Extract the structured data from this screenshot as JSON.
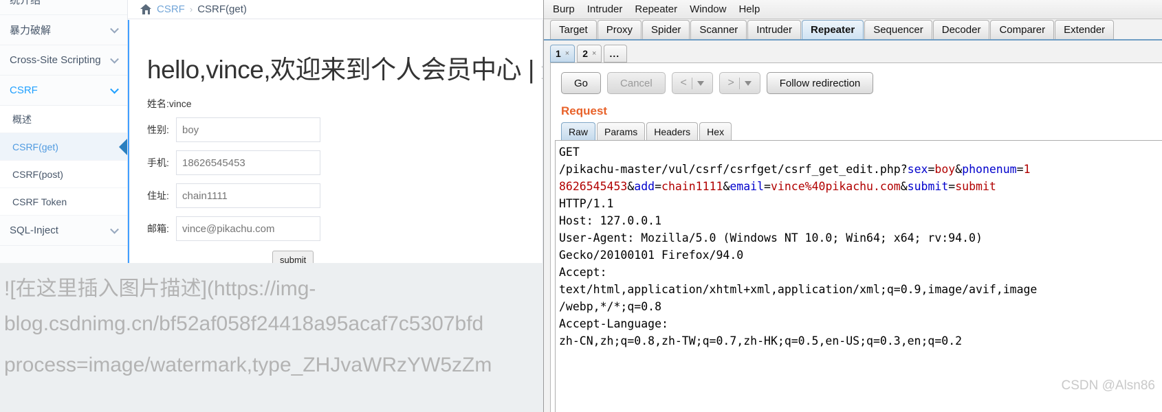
{
  "pikachu": {
    "breadcrumb": {
      "home_icon": "home-icon",
      "parent": "CSRF",
      "separator": "›",
      "current": "CSRF(get)"
    },
    "sidebar": {
      "items": [
        {
          "label": "统介绍",
          "type": "group",
          "caret": false,
          "active": false
        },
        {
          "label": "暴力破解",
          "type": "group",
          "caret": true,
          "active": false
        },
        {
          "label": "Cross-Site Scripting",
          "type": "group",
          "caret": true,
          "active": false
        },
        {
          "label": "CSRF",
          "type": "group",
          "caret": true,
          "active": true
        }
      ],
      "sub_items": [
        {
          "label": "概述",
          "selected": false
        },
        {
          "label": "CSRF(get)",
          "selected": true
        },
        {
          "label": "CSRF(post)",
          "selected": false
        },
        {
          "label": "CSRF Token",
          "selected": false
        }
      ],
      "trailing_items": [
        {
          "label": "SQL-Inject",
          "type": "group",
          "caret": true,
          "active": false
        }
      ]
    },
    "content": {
      "title": "hello,vince,欢迎来到个人会员中心 | 退",
      "name_line": "姓名:vince",
      "fields": [
        {
          "label": "性别:",
          "value": "boy"
        },
        {
          "label": "手机:",
          "value": "18626545453"
        },
        {
          "label": "住址:",
          "value": "chain1111"
        },
        {
          "label": "邮箱:",
          "value": "vince@pikachu.com"
        }
      ],
      "submit_label": "submit",
      "dashes": "--"
    },
    "watermark_lines": [
      "![在这里插入图片描述](https://img-",
      "blog.csdnimg.cn/bf52af058f24418a95acaf7c5307bfd",
      "process=image/watermark,type_ZHJvaWRzYW5zZm"
    ]
  },
  "burp": {
    "menu": [
      "Burp",
      "Intruder",
      "Repeater",
      "Window",
      "Help"
    ],
    "main_tabs": [
      {
        "label": "Target",
        "selected": false
      },
      {
        "label": "Proxy",
        "selected": false
      },
      {
        "label": "Spider",
        "selected": false
      },
      {
        "label": "Scanner",
        "selected": false
      },
      {
        "label": "Intruder",
        "selected": false
      },
      {
        "label": "Repeater",
        "selected": true
      },
      {
        "label": "Sequencer",
        "selected": false
      },
      {
        "label": "Decoder",
        "selected": false
      },
      {
        "label": "Comparer",
        "selected": false
      },
      {
        "label": "Extender",
        "selected": false
      }
    ],
    "repeater_tabs": [
      {
        "label": "1",
        "close": "×",
        "selected": true
      },
      {
        "label": "2",
        "close": "×",
        "selected": false
      },
      {
        "label": "...",
        "close": "",
        "selected": false
      }
    ],
    "toolbar": {
      "go_label": "Go",
      "cancel_label": "Cancel",
      "prev_icon": "chevron-left-icon",
      "next_icon": "chevron-right-icon",
      "follow_redirection_label": "Follow redirection"
    },
    "request_label": "Request",
    "request_label_color": "#e8622a",
    "message_tabs": [
      {
        "label": "Raw",
        "selected": true
      },
      {
        "label": "Params",
        "selected": false
      },
      {
        "label": "Headers",
        "selected": false
      },
      {
        "label": "Hex",
        "selected": false
      }
    ],
    "raw_request": {
      "lines": [
        [
          {
            "t": "GET",
            "c": "plain"
          }
        ],
        [
          {
            "t": "/pikachu-master/vul/csrf/csrfget/csrf_get_edit.php?",
            "c": "plain"
          },
          {
            "t": "sex",
            "c": "key"
          },
          {
            "t": "=",
            "c": "plain"
          },
          {
            "t": "boy",
            "c": "val"
          },
          {
            "t": "&",
            "c": "plain"
          },
          {
            "t": "phonenum",
            "c": "key"
          },
          {
            "t": "=",
            "c": "plain"
          },
          {
            "t": "1",
            "c": "val"
          }
        ],
        [
          {
            "t": "8626545453",
            "c": "val"
          },
          {
            "t": "&",
            "c": "plain"
          },
          {
            "t": "add",
            "c": "key"
          },
          {
            "t": "=",
            "c": "plain"
          },
          {
            "t": "chain1111",
            "c": "val"
          },
          {
            "t": "&",
            "c": "plain"
          },
          {
            "t": "email",
            "c": "key"
          },
          {
            "t": "=",
            "c": "plain"
          },
          {
            "t": "vince%40pikachu.com",
            "c": "val"
          },
          {
            "t": "&",
            "c": "plain"
          },
          {
            "t": "submit",
            "c": "key"
          },
          {
            "t": "=",
            "c": "plain"
          },
          {
            "t": "submit",
            "c": "val"
          }
        ],
        [
          {
            "t": "HTTP/1.1",
            "c": "plain"
          }
        ],
        [
          {
            "t": "Host: 127.0.0.1",
            "c": "plain"
          }
        ],
        [
          {
            "t": "User-Agent: Mozilla/5.0 (Windows NT 10.0; Win64; x64; rv:94.0)",
            "c": "plain"
          }
        ],
        [
          {
            "t": "Gecko/20100101 Firefox/94.0",
            "c": "plain"
          }
        ],
        [
          {
            "t": "Accept:",
            "c": "plain"
          }
        ],
        [
          {
            "t": "text/html,application/xhtml+xml,application/xml;q=0.9,image/avif,image",
            "c": "plain"
          }
        ],
        [
          {
            "t": "/webp,*/*;q=0.8",
            "c": "plain"
          }
        ],
        [
          {
            "t": "Accept-Language:",
            "c": "plain"
          }
        ],
        [
          {
            "t": "zh-CN,zh;q=0.8,zh-TW;q=0.7,zh-HK;q=0.5,en-US;q=0.3,en;q=0.2",
            "c": "plain"
          }
        ]
      ]
    }
  },
  "csdn_watermark": "CSDN @Alsn86"
}
